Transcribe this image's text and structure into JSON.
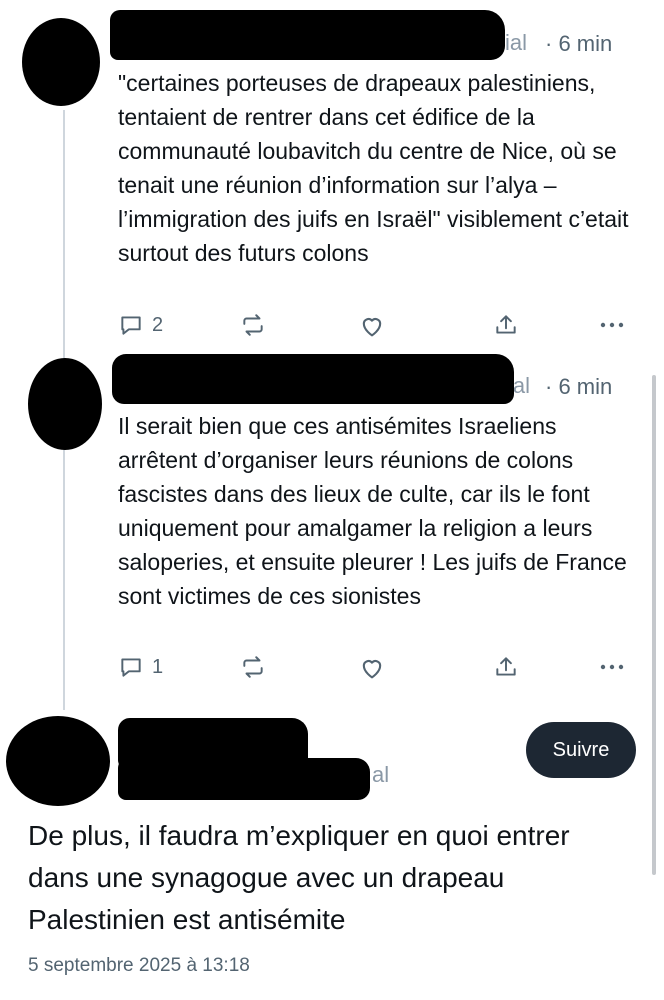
{
  "replies": [
    {
      "handle_fragment": "ial",
      "time": "· 6 min",
      "text": "\"certaines porteuses de drapeaux palestiniens, tentaient de rentrer dans cet édifice de la communauté loubavitch du centre de Nice, où se tenait une réunion d’information sur l’alya – l’immigration des juifs en Israël\" visiblement c’etait surtout des futurs colons",
      "reply_count": "2"
    },
    {
      "handle_fragment": "ial",
      "time": "· 6 min",
      "text": "Il serait bien que ces antisémites Israeliens arrêtent d’organiser leurs réunions de colons fascistes dans des lieux de culte, car ils le font uniquement pour amalgamer la religion a leurs saloperies, et ensuite pleurer ! Les juifs de France sont victimes de ces sionistes",
      "reply_count": "1"
    }
  ],
  "main_post": {
    "handle_fragment": "al",
    "follow_label": "Suivre",
    "text": "De plus, il faudra m’expliquer en quoi entrer dans une synagogue avec un drapeau Palestinien est antisémite",
    "timestamp": "5 septembre 2025 à 13:18"
  },
  "icons": [
    "reply-icon",
    "repost-icon",
    "like-icon",
    "share-icon",
    "more-icon"
  ],
  "colors": {
    "text": "#0f1419",
    "secondary": "#536471",
    "button_bg": "#1d2733",
    "thread_line": "#cfd6dd"
  }
}
